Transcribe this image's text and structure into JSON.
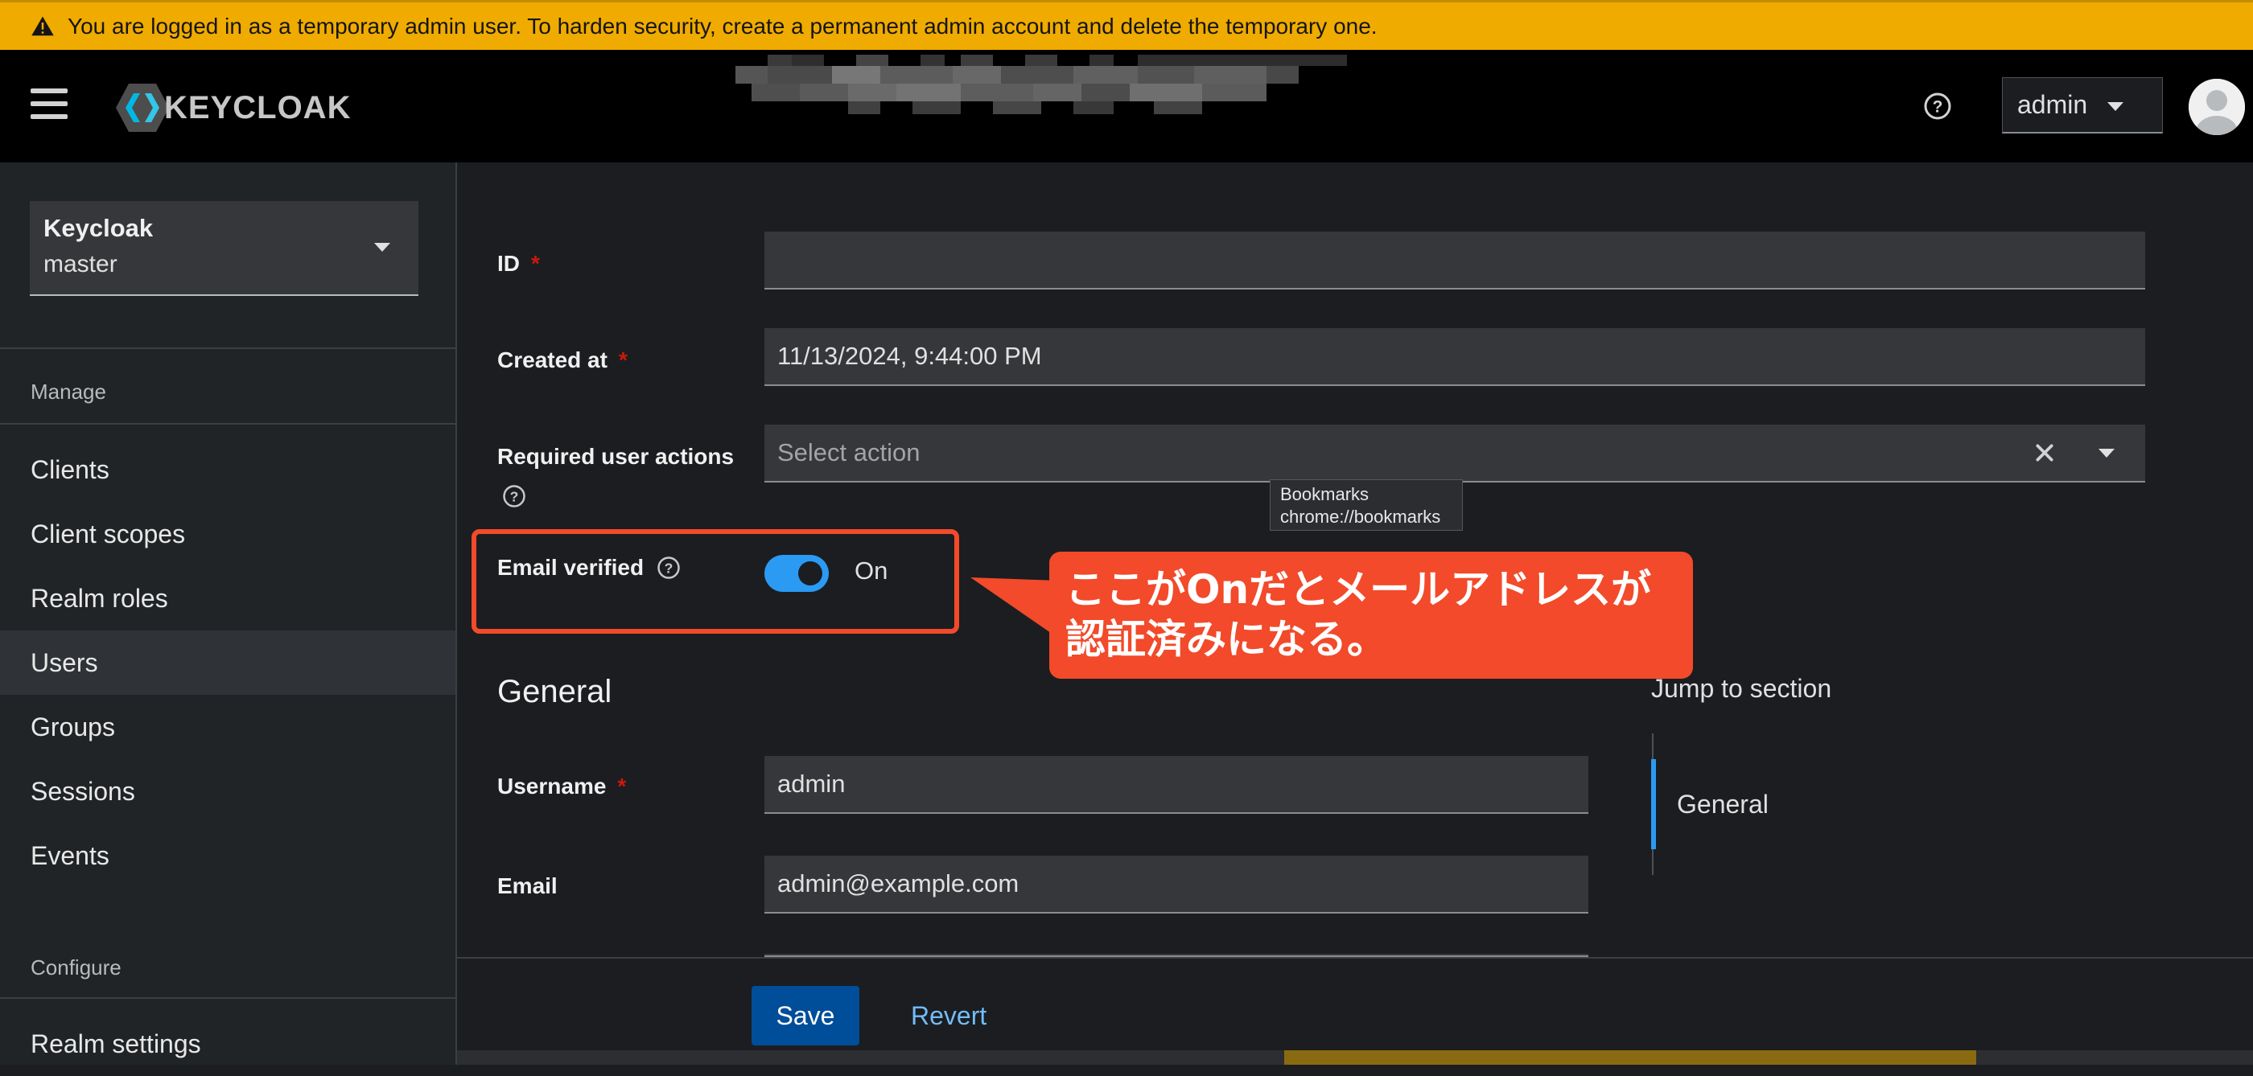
{
  "banner": {
    "text": "You are logged in as a temporary admin user. To harden security, create a permanent admin account and delete the temporary one."
  },
  "masthead": {
    "logo_text": "KEYCLOAK",
    "user_label": "admin"
  },
  "sidebar": {
    "realm": {
      "name": "Keycloak",
      "value": "master"
    },
    "manage_title": "Manage",
    "manage_items": [
      {
        "label": "Clients"
      },
      {
        "label": "Client scopes"
      },
      {
        "label": "Realm roles"
      },
      {
        "label": "Users",
        "active": true
      },
      {
        "label": "Groups"
      },
      {
        "label": "Sessions"
      },
      {
        "label": "Events"
      }
    ],
    "configure_title": "Configure",
    "configure_items": [
      {
        "label": "Realm settings"
      }
    ]
  },
  "form": {
    "id_label": "ID",
    "created_label": "Created at",
    "created_value": "11/13/2024, 9:44:00 PM",
    "actions_label": "Required user actions",
    "actions_placeholder": "Select action",
    "email_verified_label": "Email verified",
    "email_verified_state": "On",
    "email_verified": true,
    "general_heading": "General",
    "username_label": "Username",
    "username_value": "admin",
    "email_label": "Email",
    "email_value": "admin@example.com"
  },
  "tooltip": {
    "line1": "Bookmarks",
    "line2": "chrome://bookmarks"
  },
  "callout": {
    "line1": "ここがOnだとメールアドレスが",
    "line2": "認証済みになる。"
  },
  "jump": {
    "title": "Jump to section",
    "items": [
      {
        "label": "General"
      }
    ]
  },
  "footer": {
    "save_label": "Save",
    "revert_label": "Revert"
  },
  "colors": {
    "banner": "#f0ab00",
    "accent": "#2b9af3",
    "annotation": "#f24a2a",
    "primary_button": "#004d99"
  }
}
